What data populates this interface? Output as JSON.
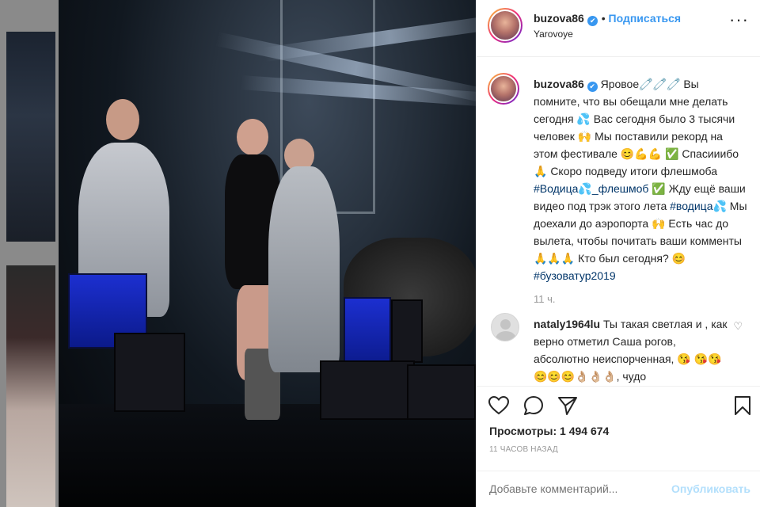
{
  "post": {
    "username": "buzova86",
    "verified_glyph": "✔",
    "follow_label": "Подписаться",
    "location": "Yarovoye",
    "more_icon": "more-dots-icon"
  },
  "caption": {
    "username": "buzova86",
    "text_1": "Яровое🧷🧷🧷 Вы помните, что вы обещали мне делать сегодня 💦 Вас сегодня было 3 тысячи человек 🙌 Мы поставили рекорд на этом фестивале 😊💪💪 ✅ Спасииибо 🙏 Скоро подведу итоги флешмоба ",
    "tag_1": "#Водица💦_флешмоб",
    "text_2": " ✅ Жду ещё ваши видео под трэк этого лета ",
    "tag_2": "#водица💦",
    "text_3": " Мы доехали до аэропорта 🙌 Есть час до вылета, чтобы почитать ваши комменты 🙏🙏🙏 Кто был сегодня? 😊 ",
    "tag_3": "#бузоватур2019",
    "time_ago": "11 ч."
  },
  "comment": {
    "username": "nataly1964lu",
    "text": "Ты такая светлая и , как верно отметил Саша рогов, абсолютно неиспорченная, 😘 😘😘😊😊😊👌🏼👌🏼👌🏼, чудо"
  },
  "stats": {
    "views_label": "Просмотры: 1 494 674",
    "ago": "11 часов назад"
  },
  "add_comment": {
    "placeholder": "Добавьте комментарий...",
    "publish_label": "Опубликовать"
  },
  "colors": {
    "accent": "#3897f0",
    "hashtag": "#003569",
    "muted": "#999999",
    "publish_disabled": "#b2dffc"
  }
}
